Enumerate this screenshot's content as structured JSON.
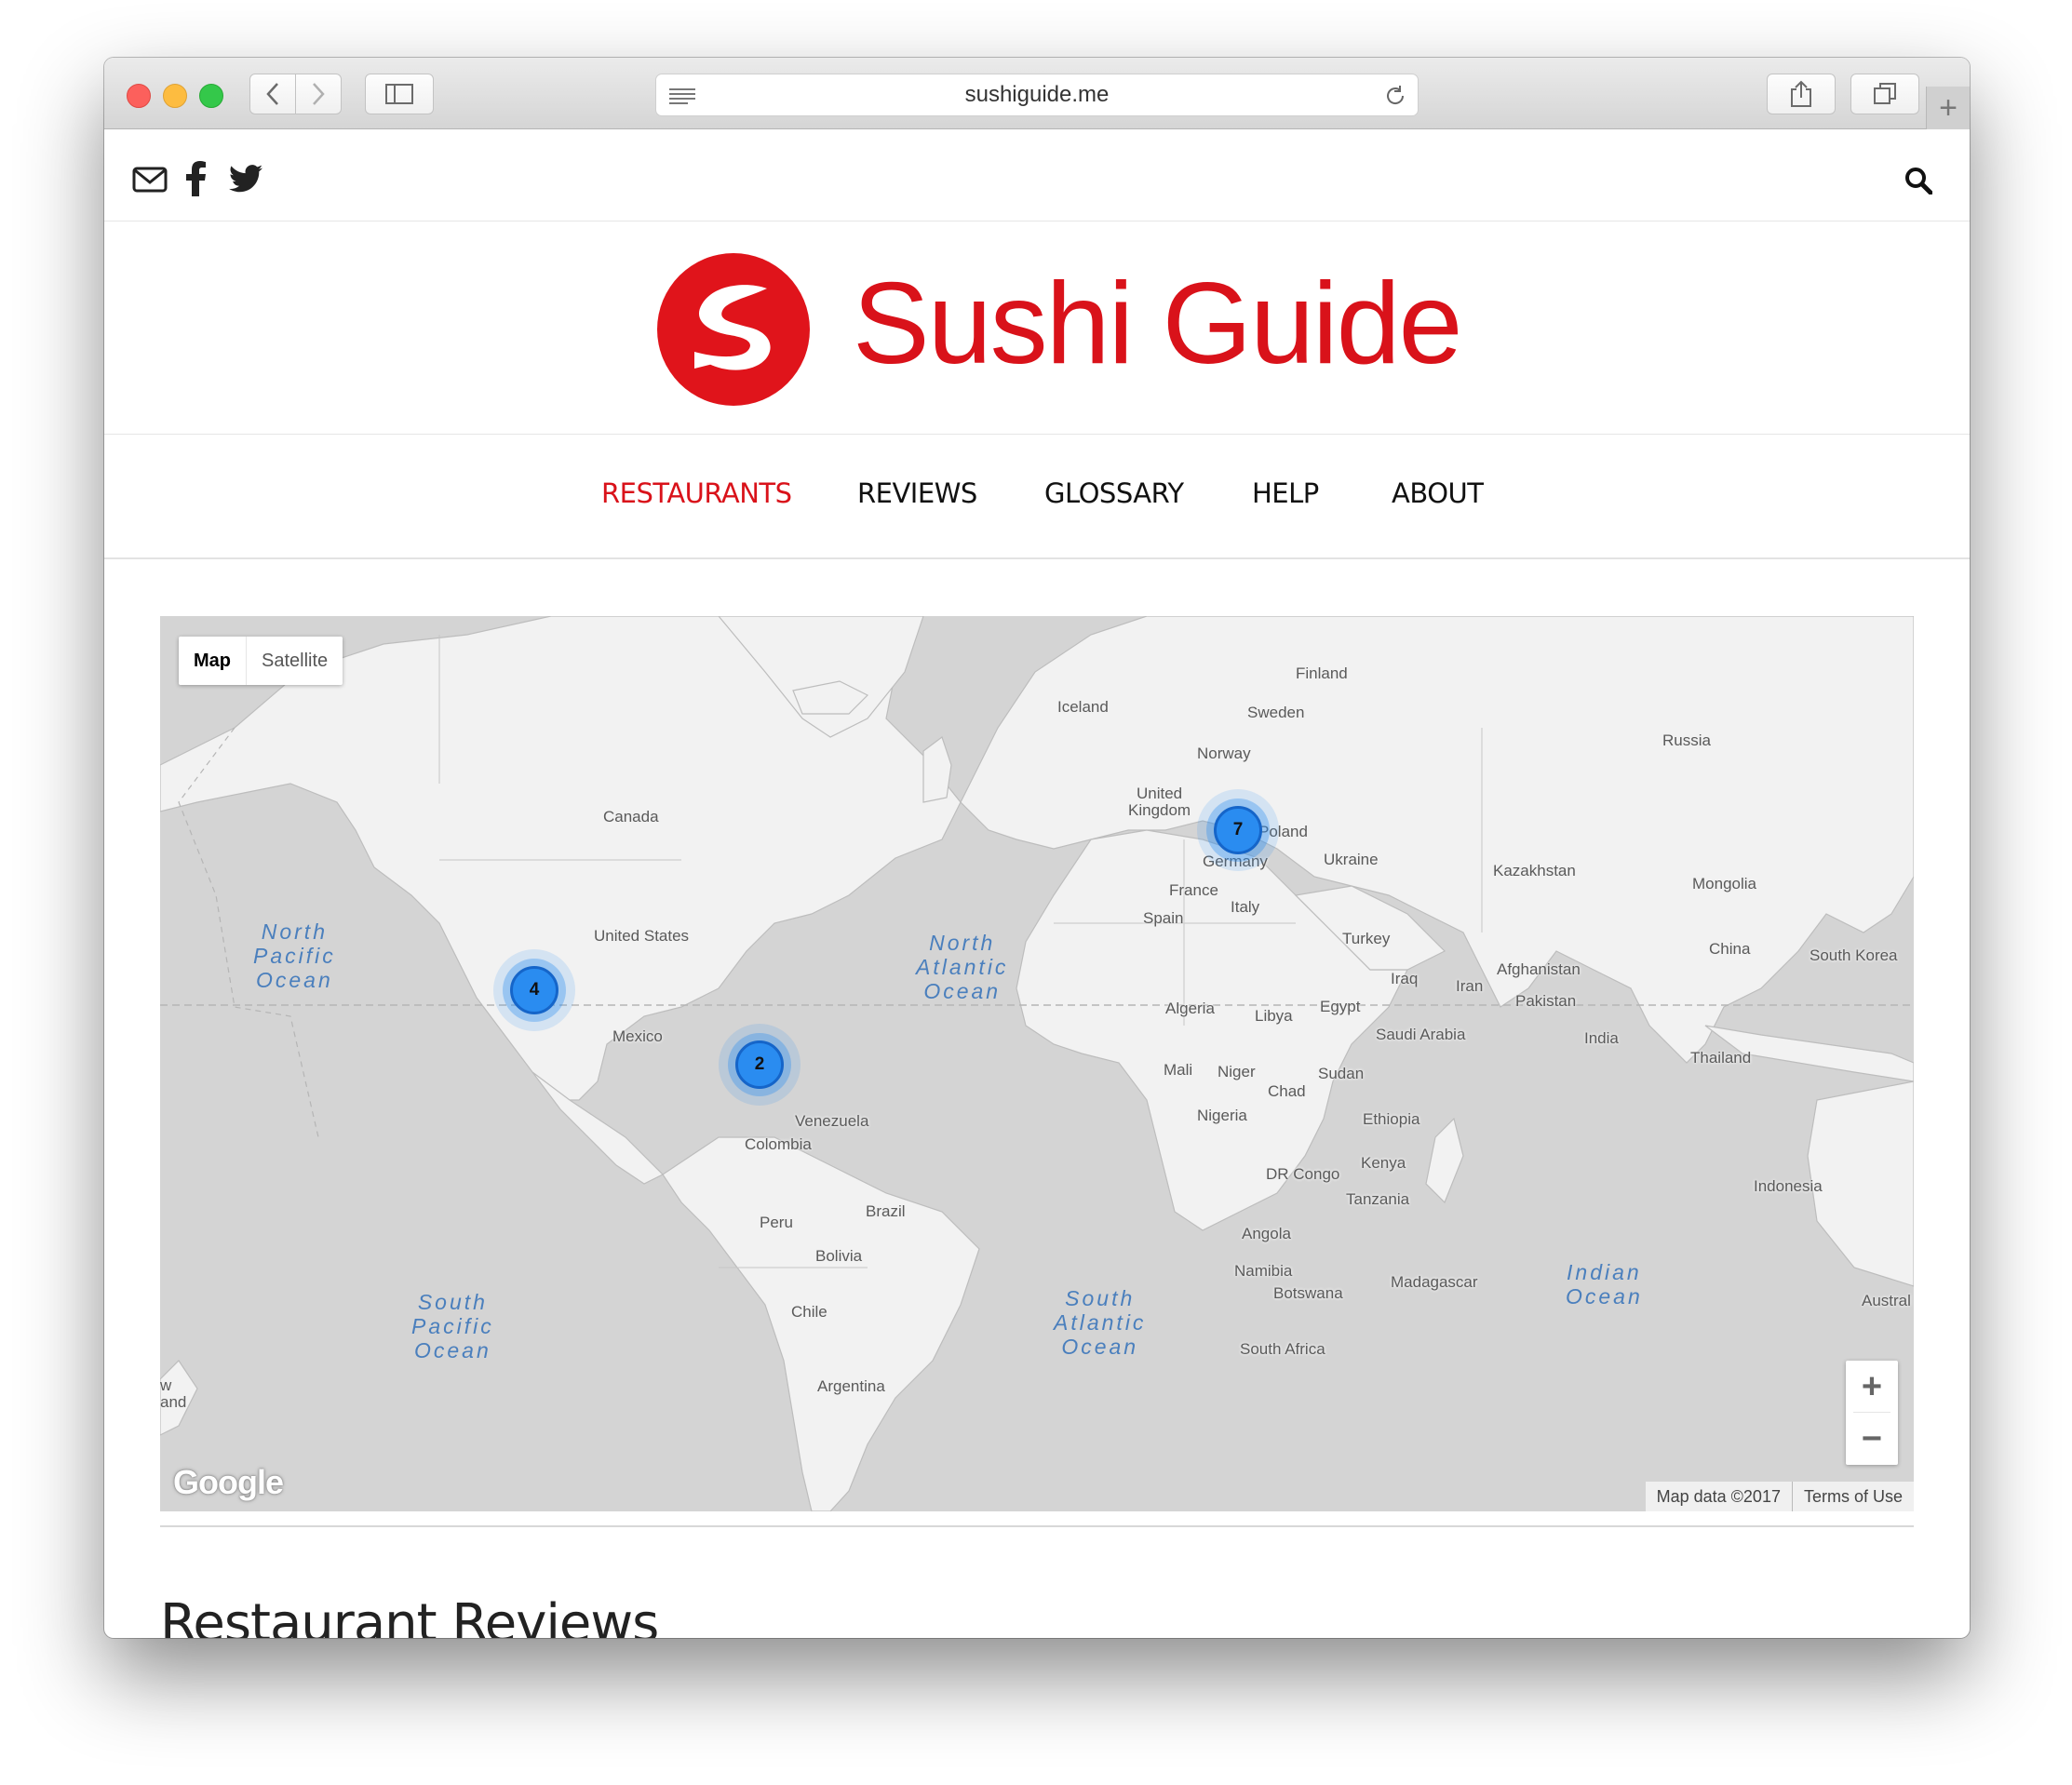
{
  "browser": {
    "url": "sushiguide.me",
    "buttons": [
      "back",
      "forward",
      "sidebar",
      "share",
      "tabs",
      "new-tab"
    ]
  },
  "social": {
    "icons": [
      "envelope-icon",
      "facebook-icon",
      "twitter-icon"
    ],
    "search_icon": "search-icon"
  },
  "brand": {
    "name": "Sushi Guide",
    "color": "#d9121a"
  },
  "nav": {
    "items": [
      {
        "label": "RESTAURANTS",
        "active": true
      },
      {
        "label": "REVIEWS",
        "active": false
      },
      {
        "label": "GLOSSARY",
        "active": false
      },
      {
        "label": "HELP",
        "active": false
      },
      {
        "label": "ABOUT",
        "active": false
      }
    ]
  },
  "map": {
    "type_buttons": {
      "map": "Map",
      "satellite": "Satellite"
    },
    "selected_type": "Map",
    "clusters": [
      {
        "count": "4",
        "region": "US West Coast"
      },
      {
        "count": "2",
        "region": "Gulf of Mexico / Florida"
      },
      {
        "count": "7",
        "region": "Central Europe"
      }
    ],
    "countries": {
      "iceland": "Iceland",
      "finland": "Finland",
      "sweden": "Sweden",
      "norway": "Norway",
      "russia": "Russia",
      "uk": "United\nKingdom",
      "poland": "Poland",
      "germany": "Germany",
      "ukraine": "Ukraine",
      "kazakhstan": "Kazakhstan",
      "mongolia": "Mongolia",
      "france": "France",
      "italy": "Italy",
      "spain": "Spain",
      "turkey": "Turkey",
      "china": "China",
      "south_korea": "South Korea",
      "iraq": "Iraq",
      "iran": "Iran",
      "afghanistan": "Afghanistan",
      "pakistan": "Pakistan",
      "canada": "Canada",
      "united_states": "United States",
      "mexico": "Mexico",
      "algeria": "Algeria",
      "libya": "Libya",
      "egypt": "Egypt",
      "saudi_arabia": "Saudi Arabia",
      "india": "India",
      "thailand": "Thailand",
      "mali": "Mali",
      "niger": "Niger",
      "sudan": "Sudan",
      "chad": "Chad",
      "nigeria": "Nigeria",
      "ethiopia": "Ethiopia",
      "venezuela": "Venezuela",
      "colombia": "Colombia",
      "kenya": "Kenya",
      "dr_congo": "DR Congo",
      "indonesia": "Indonesia",
      "tanzania": "Tanzania",
      "brazil": "Brazil",
      "peru": "Peru",
      "angola": "Angola",
      "bolivia": "Bolivia",
      "namibia": "Namibia",
      "madagascar": "Madagascar",
      "botswana": "Botswana",
      "chile": "Chile",
      "south_africa": "South Africa",
      "argentina": "Argentina",
      "australia": "Austral",
      "nz": "w\nand"
    },
    "oceans": {
      "north_pacific": "North\nPacific\nOcean",
      "north_atlantic": "North\nAtlantic\nOcean",
      "south_pacific": "South\nPacific\nOcean",
      "south_atlantic": "South\nAtlantic\nOcean",
      "indian": "Indian\nOcean"
    },
    "zoom_in": "+",
    "zoom_out": "−",
    "google_logo": "Google",
    "attribution": "Map data ©2017",
    "terms": "Terms of Use"
  },
  "section": {
    "title": "Restaurant Reviews"
  }
}
